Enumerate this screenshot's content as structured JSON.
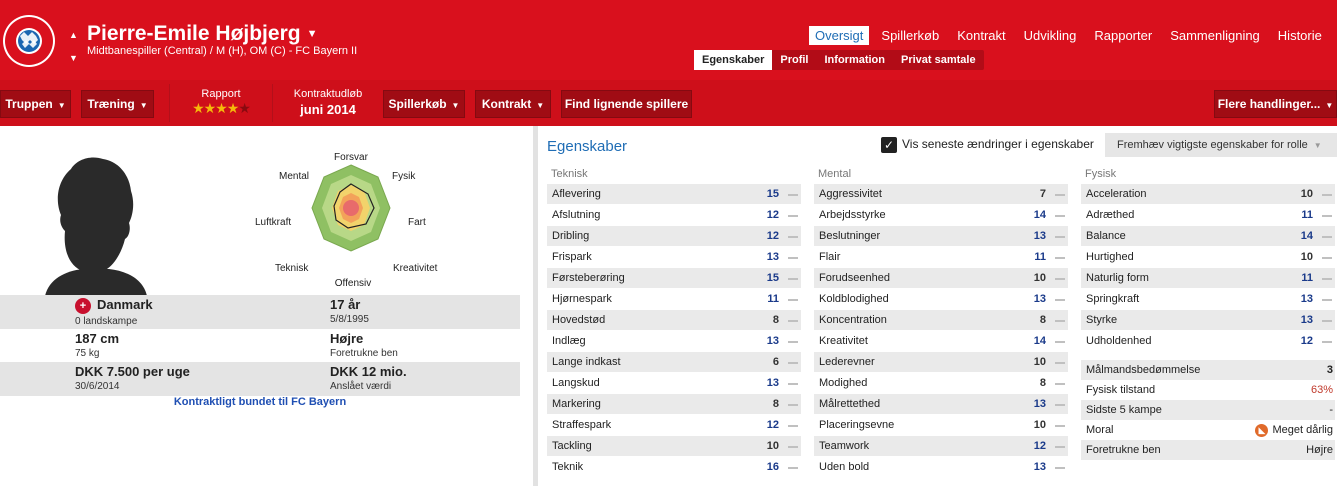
{
  "header": {
    "player_name": "Pierre-Emile Højbjerg",
    "subtitle": "Midtbanespiller (Central) / M (H), OM (C) - FC Bayern II",
    "club_crest_text": "FC BAYERN MÜNCHEN",
    "top_tabs": [
      {
        "label": "Oversigt",
        "active": true
      },
      {
        "label": "Spillerkøb",
        "active": false
      },
      {
        "label": "Kontrakt",
        "active": false
      },
      {
        "label": "Udvikling",
        "active": false
      },
      {
        "label": "Rapporter",
        "active": false
      },
      {
        "label": "Sammenligning",
        "active": false
      },
      {
        "label": "Historie",
        "active": false
      }
    ],
    "sub_tabs": [
      {
        "label": "Egenskaber",
        "active": true
      },
      {
        "label": "Profil",
        "active": false
      },
      {
        "label": "Information",
        "active": false
      },
      {
        "label": "Privat samtale",
        "active": false
      }
    ]
  },
  "toolbar": {
    "truppen": "Truppen",
    "traening": "Træning",
    "rapport_label": "Rapport",
    "rapport_stars": 4,
    "rapport_max": 5,
    "kontraktudlob_label": "Kontraktudløb",
    "kontraktudlob_value": "juni 2014",
    "spillerkob": "Spillerkøb",
    "kontrakt": "Kontrakt",
    "find": "Find lignende spillere",
    "flere": "Flere handlinger..."
  },
  "radar_labels": {
    "forsvar": "Forsvar",
    "fysik": "Fysik",
    "fart": "Fart",
    "kreativitet": "Kreativitet",
    "offensiv": "Offensiv",
    "teknisk": "Teknisk",
    "luftkraft": "Luftkraft",
    "mental": "Mental"
  },
  "info": {
    "nation": "Danmark",
    "caps": "0 landskampe",
    "age": "17 år",
    "dob": "5/8/1995",
    "height": "187 cm",
    "weight": "75 kg",
    "foot": "Højre",
    "foot_label": "Foretrukne ben",
    "wage": "DKK 7.500 per uge",
    "wage_date": "30/6/2014",
    "value": "DKK 12 mio.",
    "value_label": "Anslået værdi",
    "contract_status": "Kontraktligt bundet til FC Bayern"
  },
  "attributes": {
    "title": "Egenskaber",
    "show_changes_label": "Vis seneste ændringer i egenskaber",
    "show_changes_checked": true,
    "highlight_label": "Fremhæv vigtigste egenskaber for rolle",
    "teknisk": {
      "heading": "Teknisk",
      "rows": [
        {
          "name": "Aflevering",
          "value": "15",
          "key": true
        },
        {
          "name": "Afslutning",
          "value": "12",
          "key": true
        },
        {
          "name": "Dribling",
          "value": "12",
          "key": true
        },
        {
          "name": "Frispark",
          "value": "13",
          "key": true
        },
        {
          "name": "Førsteberøring",
          "value": "15",
          "key": true
        },
        {
          "name": "Hjørnespark",
          "value": "11",
          "key": true
        },
        {
          "name": "Hovedstød",
          "value": "8",
          "key": false
        },
        {
          "name": "Indlæg",
          "value": "13",
          "key": true
        },
        {
          "name": "Lange indkast",
          "value": "6",
          "key": false
        },
        {
          "name": "Langskud",
          "value": "13",
          "key": true
        },
        {
          "name": "Markering",
          "value": "8",
          "key": false
        },
        {
          "name": "Straffespark",
          "value": "12",
          "key": true
        },
        {
          "name": "Tackling",
          "value": "10",
          "key": false
        },
        {
          "name": "Teknik",
          "value": "16",
          "key": true
        }
      ]
    },
    "mental": {
      "heading": "Mental",
      "rows": [
        {
          "name": "Aggressivitet",
          "value": "7",
          "key": false
        },
        {
          "name": "Arbejdsstyrke",
          "value": "14",
          "key": true
        },
        {
          "name": "Beslutninger",
          "value": "13",
          "key": true
        },
        {
          "name": "Flair",
          "value": "11",
          "key": true
        },
        {
          "name": "Forudseenhed",
          "value": "10",
          "key": false
        },
        {
          "name": "Koldblodighed",
          "value": "13",
          "key": true
        },
        {
          "name": "Koncentration",
          "value": "8",
          "key": false
        },
        {
          "name": "Kreativitet",
          "value": "14",
          "key": true
        },
        {
          "name": "Lederevner",
          "value": "10",
          "key": false
        },
        {
          "name": "Modighed",
          "value": "8",
          "key": false
        },
        {
          "name": "Målrettethed",
          "value": "13",
          "key": true
        },
        {
          "name": "Placeringsevne",
          "value": "10",
          "key": false
        },
        {
          "name": "Teamwork",
          "value": "12",
          "key": true
        },
        {
          "name": "Uden bold",
          "value": "13",
          "key": true
        }
      ]
    },
    "fysisk": {
      "heading": "Fysisk",
      "rows": [
        {
          "name": "Acceleration",
          "value": "10",
          "key": false
        },
        {
          "name": "Adræthed",
          "value": "11",
          "key": true
        },
        {
          "name": "Balance",
          "value": "14",
          "key": true
        },
        {
          "name": "Hurtighed",
          "value": "10",
          "key": false
        },
        {
          "name": "Naturlig form",
          "value": "11",
          "key": true
        },
        {
          "name": "Springkraft",
          "value": "13",
          "key": true
        },
        {
          "name": "Styrke",
          "value": "13",
          "key": true
        },
        {
          "name": "Udholdenhed",
          "value": "12",
          "key": true
        }
      ]
    },
    "extra": [
      {
        "name": "Målmandsbedømmelse",
        "value": "3"
      },
      {
        "name": "Fysisk tilstand",
        "value": "63%"
      },
      {
        "name": "Sidste 5 kampe",
        "value": "-"
      },
      {
        "name": "Moral",
        "value": "Meget dårlig"
      },
      {
        "name": "Foretrukne ben",
        "value": "Højre"
      }
    ]
  },
  "colors": {
    "header_red": "#d9101d",
    "toolbar_red": "#ce0f1a",
    "button_red": "#a00c14",
    "link_blue": "#1f6db5",
    "condition_red": "#c0392b"
  }
}
